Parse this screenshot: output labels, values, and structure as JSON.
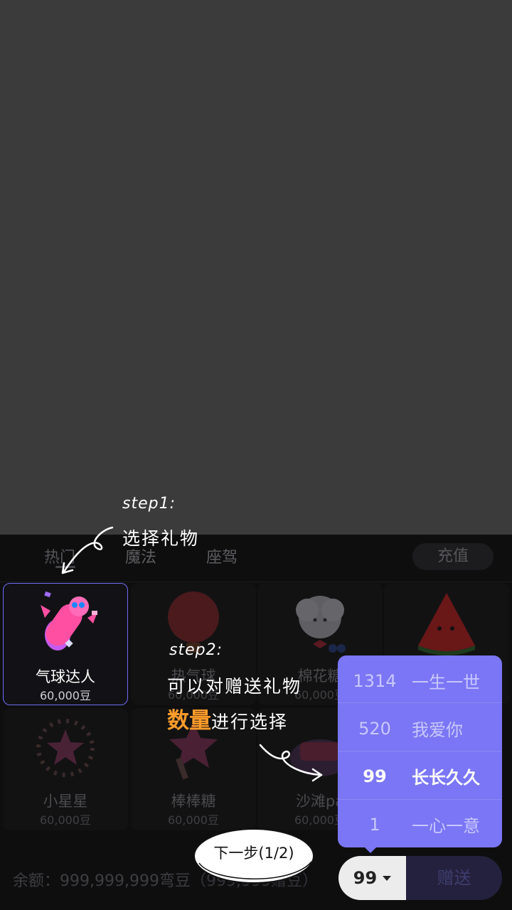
{
  "tabs": [
    {
      "label": "热门",
      "active": true
    },
    {
      "label": "魔法",
      "active": false
    },
    {
      "label": "座驾",
      "active": false
    }
  ],
  "recharge_label": "充值",
  "gifts": [
    {
      "name": "气球达人",
      "price": "60,000豆",
      "selected": true,
      "icon": "balloon-figure-icon"
    },
    {
      "name": "热气球",
      "price": "60,000豆",
      "selected": false,
      "icon": "hot-air-balloon-icon"
    },
    {
      "name": "棉花糖",
      "price": "60,000豆",
      "selected": false,
      "icon": "cotton-candy-icon"
    },
    {
      "name": "",
      "price": "",
      "selected": false,
      "icon": "watermelon-icon"
    },
    {
      "name": "小星星",
      "price": "60,000豆",
      "selected": false,
      "icon": "star-icon"
    },
    {
      "name": "棒棒糖",
      "price": "60,000豆",
      "selected": false,
      "icon": "lollipop-icon"
    },
    {
      "name": "沙滩pa",
      "price": "60,000豆",
      "selected": false,
      "icon": "beach-party-icon"
    }
  ],
  "balance_text": "余额：999,999,999弯豆",
  "balance_extra": "（999,999赠豆）",
  "send": {
    "quantity": "99",
    "send_label": "赠送"
  },
  "quantity_options": [
    {
      "num": "1314",
      "text": "一生一世",
      "selected": false
    },
    {
      "num": "520",
      "text": "我爱你",
      "selected": false
    },
    {
      "num": "99",
      "text": "长长久久",
      "selected": true
    },
    {
      "num": "1",
      "text": "一心一意",
      "selected": false
    }
  ],
  "guide": {
    "step1_label": "step1:",
    "step1_text": "选择礼物",
    "step2_label": "step2:",
    "step2_line1": "可以对赠送礼物",
    "step2_accent": "数量",
    "step2_line2": "进行选择",
    "next_label": "下一步(1/2)"
  },
  "colors": {
    "accent_purple": "#7a76f5",
    "highlight_orange": "#ff9c2a"
  }
}
